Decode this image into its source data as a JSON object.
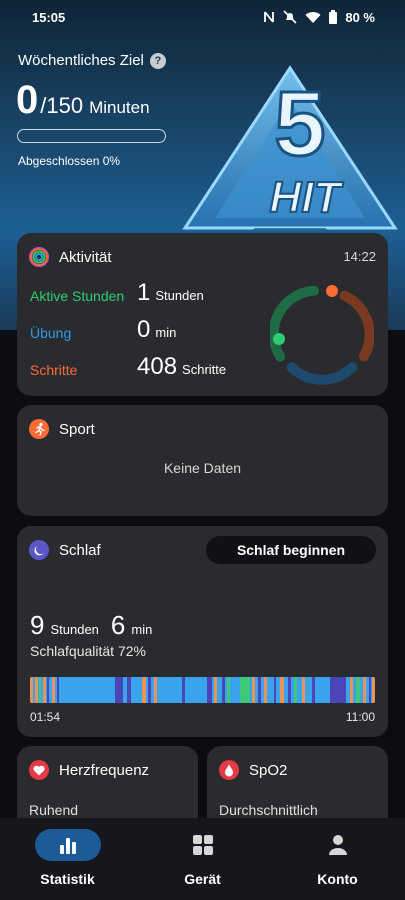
{
  "status_bar": {
    "time": "15:05",
    "battery": "80 %"
  },
  "weekly_goal": {
    "title": "Wöchentliches Ziel",
    "current": "0",
    "total": "/150",
    "unit": "Minuten",
    "progress": 0,
    "completed_label": "Abgeschlossen 0%"
  },
  "hero_badge": {
    "number": "5",
    "text": "HIT"
  },
  "activity": {
    "title": "Aktivität",
    "time": "14:22",
    "metrics": [
      {
        "label": "Aktive Stunden",
        "value": "1",
        "unit": "Stunden",
        "color": "#2ecc71"
      },
      {
        "label": "Übung",
        "value": "0",
        "unit": "min",
        "color": "#2f9be6"
      },
      {
        "label": "Schritte",
        "value": "408",
        "unit": "Schritte",
        "color": "#ff6b35"
      }
    ]
  },
  "sport": {
    "title": "Sport",
    "empty": "Keine Daten"
  },
  "sleep": {
    "title": "Schlaf",
    "button": "Schlaf beginnen",
    "hours": "9",
    "hours_unit": "Stunden",
    "minutes": "6",
    "minutes_unit": "min",
    "quality": "Schlafqualität 72%",
    "start": "01:54",
    "end": "11:00"
  },
  "heart_rate": {
    "title": "Herzfrequenz",
    "sub": "Ruhend"
  },
  "spo2": {
    "title": "SpO2",
    "sub": "Durchschnittlich"
  },
  "nav": [
    {
      "label": "Statistik",
      "icon": "bar-chart-icon",
      "active": true
    },
    {
      "label": "Gerät",
      "icon": "grid-icon",
      "active": false
    },
    {
      "label": "Konto",
      "icon": "person-icon",
      "active": false
    }
  ],
  "colors": {
    "accent": "#1c5b97",
    "active_green": "#2ecc71",
    "exercise_blue": "#2f9be6",
    "steps_orange": "#ff6b35",
    "card_bg": "#2a2b2f"
  }
}
